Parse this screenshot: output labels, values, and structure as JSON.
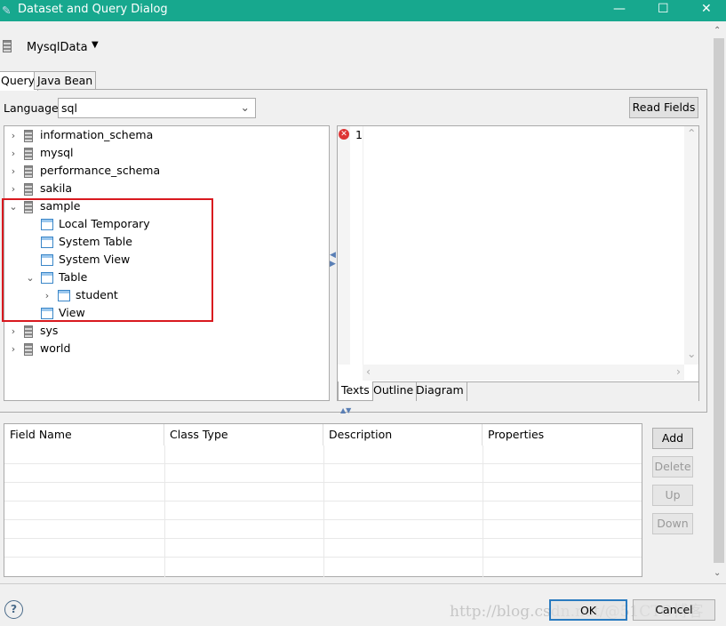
{
  "window": {
    "title": "Dataset and Query Dialog",
    "minimize": "—",
    "maximize": "☐",
    "close": "✕"
  },
  "datasource": {
    "name": "MysqlData"
  },
  "tabs": [
    {
      "label": "Query"
    },
    {
      "label": "Java Bean"
    }
  ],
  "language": {
    "label": "Language",
    "value": "sql"
  },
  "read_fields_label": "Read Fields",
  "tree": [
    {
      "label": "information_schema",
      "level": 0,
      "chevron": "›",
      "icon": "db"
    },
    {
      "label": "mysql",
      "level": 0,
      "chevron": "›",
      "icon": "db"
    },
    {
      "label": "performance_schema",
      "level": 0,
      "chevron": "›",
      "icon": "db"
    },
    {
      "label": "sakila",
      "level": 0,
      "chevron": "›",
      "icon": "db"
    },
    {
      "label": "sample",
      "level": 0,
      "chevron": "⌄",
      "icon": "db"
    },
    {
      "label": "Local Temporary",
      "level": 1,
      "chevron": "",
      "icon": "table"
    },
    {
      "label": "System Table",
      "level": 1,
      "chevron": "",
      "icon": "table"
    },
    {
      "label": "System View",
      "level": 1,
      "chevron": "",
      "icon": "table"
    },
    {
      "label": "Table",
      "level": 1,
      "chevron": "⌄",
      "icon": "table"
    },
    {
      "label": "student",
      "level": 2,
      "chevron": "›",
      "icon": "table"
    },
    {
      "label": "View",
      "level": 1,
      "chevron": "",
      "icon": "table"
    },
    {
      "label": "sys",
      "level": 0,
      "chevron": "›",
      "icon": "db"
    },
    {
      "label": "world",
      "level": 0,
      "chevron": "›",
      "icon": "db"
    }
  ],
  "editor": {
    "line_number": "1",
    "error_icon": "error-icon",
    "tabs": [
      {
        "label": "Texts"
      },
      {
        "label": "Outline"
      },
      {
        "label": "Diagram"
      }
    ]
  },
  "fields_table": {
    "columns": [
      "Field Name",
      "Class Type",
      "Description",
      "Properties"
    ],
    "rows": []
  },
  "side_buttons": [
    {
      "label": "Add",
      "enabled": true
    },
    {
      "label": "Delete",
      "enabled": false
    },
    {
      "label": "Up",
      "enabled": false
    },
    {
      "label": "Down",
      "enabled": false
    }
  ],
  "footer": {
    "help": "?",
    "ok": "OK",
    "cancel": "Cancel",
    "watermark": "http://blog.csdn.net/@51CTO博客"
  },
  "colors": {
    "titlebar": "#17a88e",
    "highlight": "#d9191f",
    "ok_border": "#2a7bc0"
  }
}
